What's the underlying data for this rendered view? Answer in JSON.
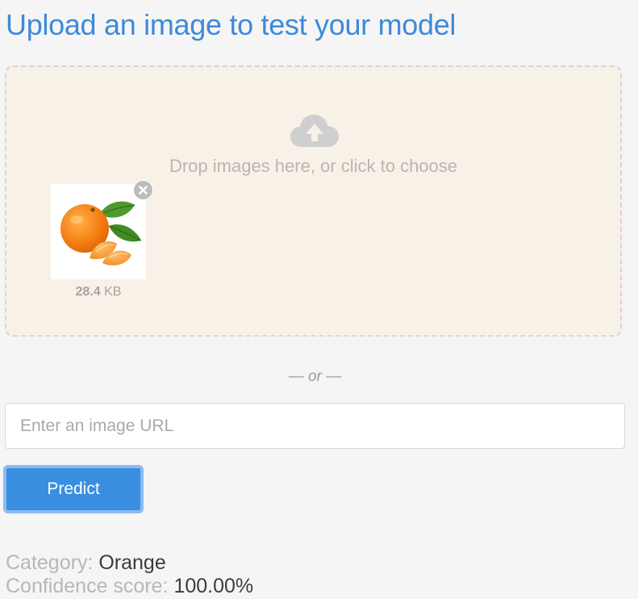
{
  "page": {
    "title": "Upload an image to test your model"
  },
  "dropzone": {
    "message": "Drop images here, or click to choose",
    "upload_icon": "cloud-upload-icon",
    "file": {
      "size_value": "28.4",
      "size_unit": "KB",
      "thumbnail": "orange-fruit-image",
      "remove_icon": "close-circle-icon"
    }
  },
  "separator": "— or —",
  "url_input": {
    "placeholder": "Enter an image URL",
    "value": ""
  },
  "predict_button": {
    "label": "Predict"
  },
  "results": {
    "category_label": "Category:",
    "category_value": "Orange",
    "confidence_label": "Confidence score:",
    "confidence_value": "100.00%"
  },
  "colors": {
    "title": "#3d8ad8",
    "button": "#3a8ee0",
    "dropzone_bg": "#f8f1e7"
  }
}
